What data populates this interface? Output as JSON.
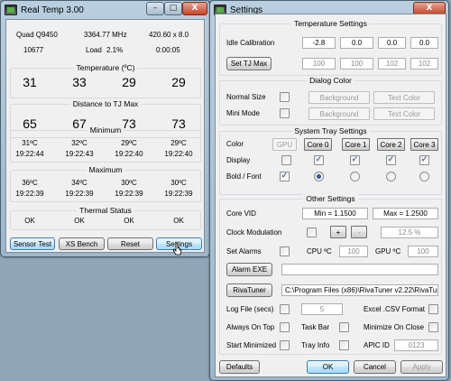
{
  "realtemp": {
    "title": "Real Temp 3.00",
    "cpu_name": "Quad Q9450",
    "cpu_mhz": "3364.77 MHz",
    "cpu_multi": "420.60 x 8.0",
    "vid_value": "10677",
    "load_label": "Load",
    "load_value": "2.1%",
    "time": "0:00:05",
    "temp_title": "Temperature (ºC)",
    "temps": [
      "31",
      "33",
      "29",
      "29"
    ],
    "tjmax_title": "Distance to TJ Max",
    "distances": [
      "65",
      "67",
      "73",
      "73"
    ],
    "min_title": "Minimum",
    "min_temps": [
      "31ºC",
      "32ºC",
      "29ºC",
      "29ºC"
    ],
    "min_times": [
      "19:22:44",
      "19:22:43",
      "19:22:40",
      "19:22:40"
    ],
    "max_title": "Maximum",
    "max_temps": [
      "36ºC",
      "34ºC",
      "30ºC",
      "30ºC"
    ],
    "max_times": [
      "19:22:39",
      "19:22:39",
      "19:22:39",
      "19:22:39"
    ],
    "thermal_title": "Thermal Status",
    "thermal": [
      "OK",
      "OK",
      "OK",
      "OK"
    ],
    "buttons": {
      "sensor_test": "Sensor Test",
      "xs_bench": "XS Bench",
      "reset": "Reset",
      "settings": "Settings"
    },
    "window_controls": {
      "minimize": "–",
      "maximize": "□",
      "close": "X"
    }
  },
  "settings": {
    "title": "Settings",
    "close_glyph": "X",
    "temp_settings": {
      "title": "Temperature Settings",
      "idle_label": "Idle Calibration",
      "idle_values": [
        "-2.8",
        "0.0",
        "0.0",
        "0.0"
      ],
      "set_tj_label": "Set TJ Max",
      "tj_values": [
        "100",
        "100",
        "102",
        "102"
      ]
    },
    "dialog_color": {
      "title": "Dialog Color",
      "normal_label": "Normal Size",
      "mini_label": "Mini Mode",
      "background": "Background",
      "text_color": "Text Color"
    },
    "tray": {
      "title": "System Tray Settings",
      "color_label": "Color",
      "gpu_label": "GPU",
      "cores": [
        "Core 0",
        "Core 1",
        "Core 2",
        "Core 3"
      ],
      "display_label": "Display",
      "display_checks": [
        false,
        true,
        true,
        true,
        true
      ],
      "bold_label": "Bold / Font",
      "bold_check": true,
      "radio_selected": 1
    },
    "other": {
      "title": "Other Settings",
      "core_vid_label": "Core VID",
      "min_vid": "Min = 1.1500",
      "max_vid": "Max = 1.2500",
      "clock_mod_label": "Clock Modulation",
      "plus": "+",
      "minus": "-",
      "clock_mod_value": "12.5 %",
      "set_alarms_label": "Set Alarms",
      "cpu_label": "CPU ºC",
      "cpu_value": "100",
      "gpu_label": "GPU ºC",
      "gpu_value": "100",
      "alarm_exe_label": "Alarm EXE",
      "alarm_exe_path": "",
      "rivatuner_label": "RivaTuner",
      "rivatuner_path": "C:\\Program Files (x86)\\RivaTuner v2.22\\RivaTun",
      "log_label": "Log File (secs)",
      "log_value": "5",
      "excel_label": "Excel .CSV Format",
      "always_on_top_label": "Always On Top",
      "task_bar_label": "Task Bar",
      "min_on_close_label": "Minimize On Close",
      "start_min_label": "Start Minimized",
      "tray_info_label": "Tray Info",
      "apic_label": "APIC ID",
      "apic_value": "0123"
    },
    "buttons": {
      "defaults": "Defaults",
      "ok": "OK",
      "cancel": "Cancel",
      "apply": "Apply"
    }
  }
}
